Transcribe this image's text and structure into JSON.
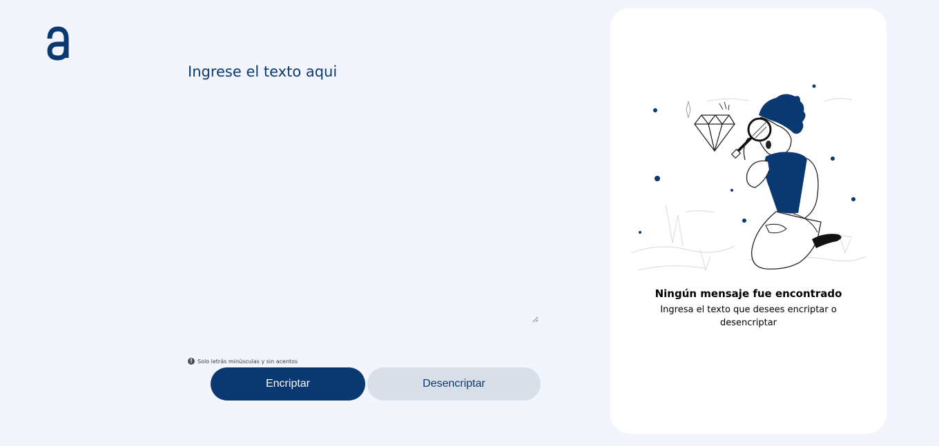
{
  "colors": {
    "background": "#f3f5fc",
    "primary": "#0a3871",
    "secondary_button": "#d8dfe8",
    "card": "#ffffff"
  },
  "brand": {
    "logo_icon": "alura-a-logo-icon"
  },
  "input": {
    "placeholder": "Ingrese el texto aqui",
    "value": ""
  },
  "hint": {
    "icon": "info-circle-icon",
    "text": "Solo letrás minúsculas y sin acentos"
  },
  "buttons": {
    "encrypt_label": "Encriptar",
    "decrypt_label": "Desencriptar"
  },
  "output": {
    "illustration": "person-with-magnifying-glass-illustration",
    "title": "Ningún mensaje fue encontrado",
    "description": "Ingresa el texto que desees encriptar o desencriptar"
  }
}
